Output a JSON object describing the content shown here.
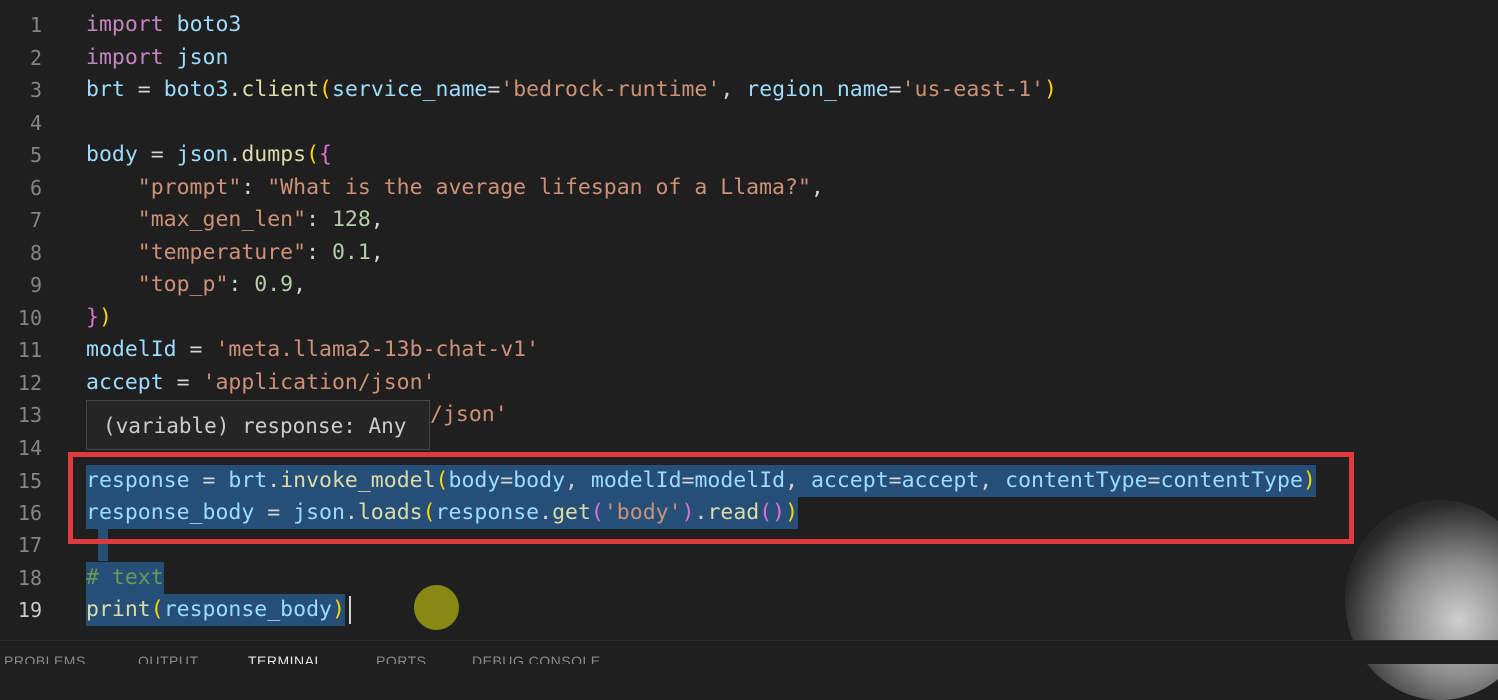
{
  "editor": {
    "line_numbers": [
      "1",
      "2",
      "3",
      "4",
      "5",
      "6",
      "7",
      "8",
      "9",
      "10",
      "11",
      "12",
      "13",
      "14",
      "15",
      "16",
      "17",
      "18",
      "19"
    ],
    "line13_visible_text": "/json'",
    "hover_tooltip": "(variable) response: Any",
    "line19_comment": "# text"
  },
  "panel": {
    "tabs": [
      "PROBLEMS",
      "OUTPUT",
      "TERMINAL",
      "PORTS",
      "DEBUG CONSOLE"
    ],
    "active_tab": "TERMINAL"
  },
  "colors": {
    "highlight_box": "#e0393e",
    "selection": "#264f78",
    "background": "#1f1f1f"
  }
}
